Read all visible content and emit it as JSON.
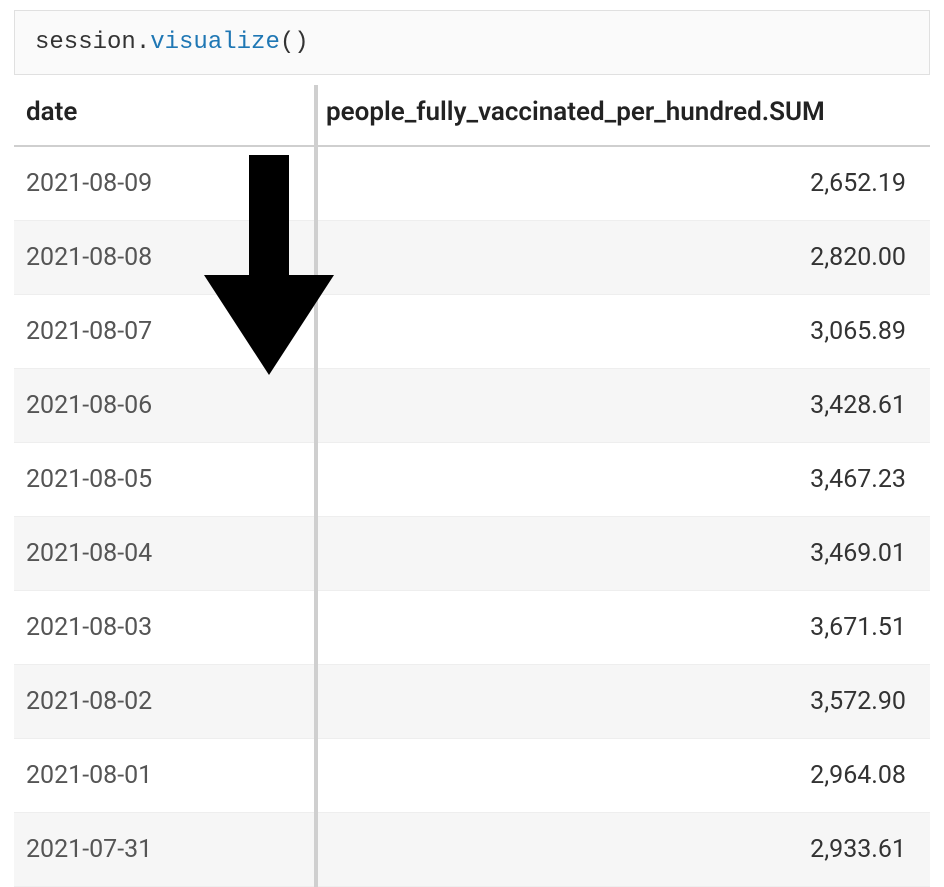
{
  "code": {
    "prefix": "session.",
    "fn": "visualize",
    "suffix": "()"
  },
  "chart_data": {
    "type": "table",
    "columns": [
      "date",
      "people_fully_vaccinated_per_hundred.SUM"
    ],
    "rows": [
      {
        "date": "2021-08-09",
        "value": "2,652.19"
      },
      {
        "date": "2021-08-08",
        "value": "2,820.00"
      },
      {
        "date": "2021-08-07",
        "value": "3,065.89"
      },
      {
        "date": "2021-08-06",
        "value": "3,428.61"
      },
      {
        "date": "2021-08-05",
        "value": "3,467.23"
      },
      {
        "date": "2021-08-04",
        "value": "3,469.01"
      },
      {
        "date": "2021-08-03",
        "value": "3,671.51"
      },
      {
        "date": "2021-08-02",
        "value": "3,572.90"
      },
      {
        "date": "2021-08-01",
        "value": "2,964.08"
      },
      {
        "date": "2021-07-31",
        "value": "2,933.61"
      }
    ]
  }
}
